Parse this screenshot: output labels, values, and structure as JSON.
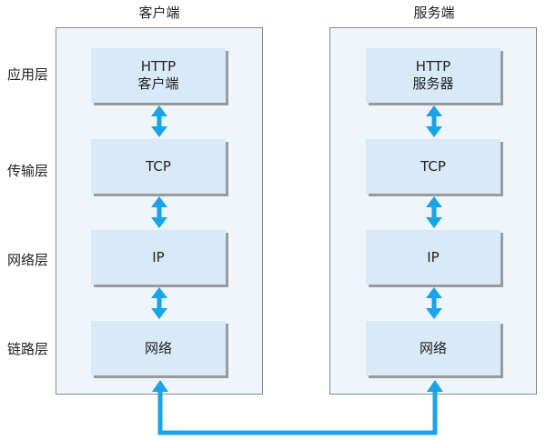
{
  "columns": {
    "client": {
      "title": "客户端",
      "boxes": [
        {
          "line1": "HTTP",
          "line2": "客户端"
        },
        {
          "line1": "TCP",
          "line2": ""
        },
        {
          "line1": "IP",
          "line2": ""
        },
        {
          "line1": "网络",
          "line2": ""
        }
      ]
    },
    "server": {
      "title": "服务端",
      "boxes": [
        {
          "line1": "HTTP",
          "line2": "服务器"
        },
        {
          "line1": "TCP",
          "line2": ""
        },
        {
          "line1": "IP",
          "line2": ""
        },
        {
          "line1": "网络",
          "line2": ""
        }
      ]
    }
  },
  "layers": [
    "应用层",
    "传输层",
    "网络层",
    "链路层"
  ],
  "colors": {
    "arrow": "#1aa3e8",
    "panel_bg": "#eef6fc",
    "box_bg": "#d8e9f7"
  }
}
